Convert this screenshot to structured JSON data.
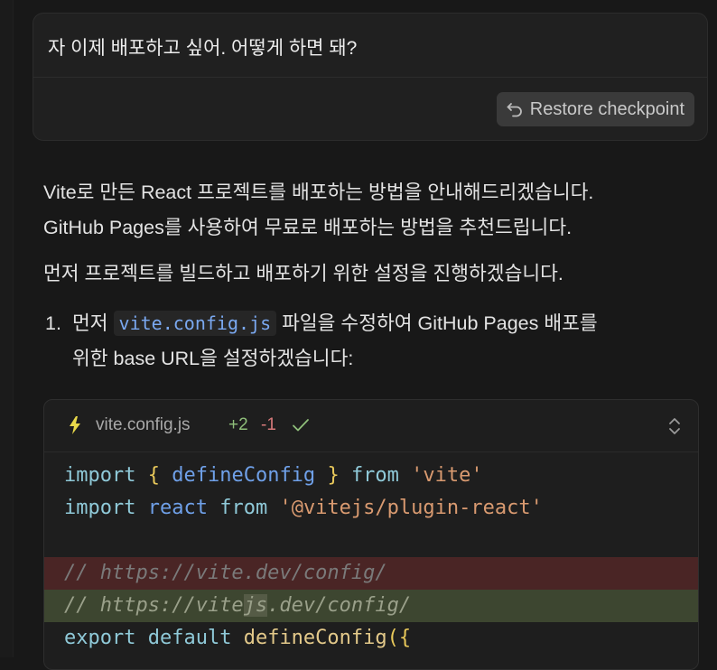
{
  "user_message": {
    "text": "자 이제 배포하고 싶어. 어떻게 하면 돼?",
    "restore_label": "Restore checkpoint"
  },
  "assistant": {
    "para1_line1": "Vite로 만든 React 프로젝트를 배포하는 방법을 안내해드리겠습니다.",
    "para1_line2": "GitHub Pages를 사용하여 무료로 배포하는 방법을 추천드립니다.",
    "para2": "먼저 프로젝트를 빌드하고 배포하기 위한 설정을 진행하겠습니다.",
    "step1": {
      "number": "1.",
      "before": "먼저 ",
      "code": "vite.config.js",
      "after_line1": " 파일을 수정하여 GitHub Pages 배포를",
      "line2": "위한 base URL을 설정하겠습니다:"
    }
  },
  "code_block": {
    "file_name": "vite.config.js",
    "additions": "+2",
    "deletions": "-1",
    "lines": {
      "l1_kw": "import",
      "l1_brace_open": "{",
      "l1_name": "defineConfig",
      "l1_brace_close": "}",
      "l1_from": "from",
      "l1_str": "'vite'",
      "l2_kw": "import",
      "l2_name": "react",
      "l2_from": "from",
      "l2_str": "'@vitejs/plugin-react'",
      "removed_comment": "// https://vite.dev/config/",
      "added_prefix": "// https://vite",
      "added_highlight": "js",
      "added_suffix": ".dev/config/",
      "l6_export": "export",
      "l6_default": "default",
      "l6_fn": "defineConfig",
      "l6_paren": "(",
      "l6_brace": "{"
    }
  },
  "colors": {
    "background": "#181818",
    "additions": "#8fbf7a",
    "deletions": "#d6797a",
    "inline_code": "#7aa8f0",
    "bolt_icon": "#e8d84a"
  },
  "icons": [
    "undo-icon",
    "bolt-icon",
    "check-icon",
    "expand-icon"
  ]
}
